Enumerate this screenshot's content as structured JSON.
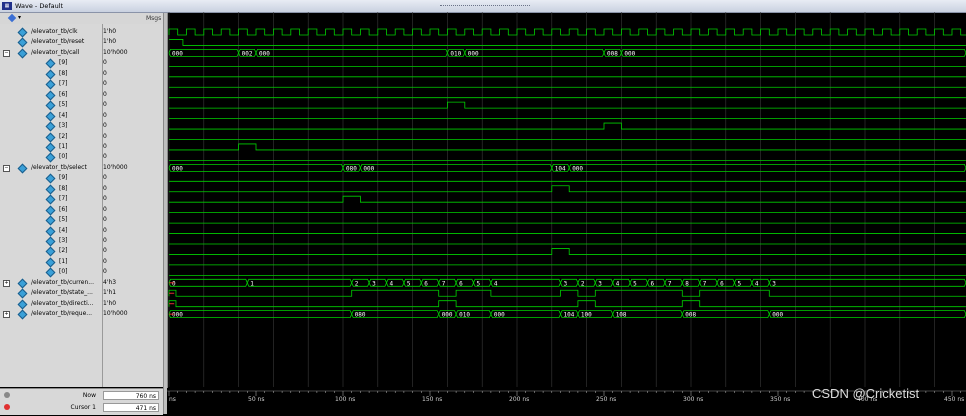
{
  "window": {
    "title": "Wave - Default",
    "icon": "wave-window-icon"
  },
  "header": {
    "msgs_label": "Msgs"
  },
  "signals": [
    {
      "name": "/elevator_tb/clk",
      "value": "1'h0",
      "level": 0,
      "expandable": false
    },
    {
      "name": "/elevator_tb/reset",
      "value": "1'h0",
      "level": 0,
      "expandable": false
    },
    {
      "name": "/elevator_tb/call",
      "value": "10'h000",
      "level": 0,
      "expandable": true,
      "expanded": true
    },
    {
      "name": "[9]",
      "value": "0",
      "level": 1
    },
    {
      "name": "[8]",
      "value": "0",
      "level": 1
    },
    {
      "name": "[7]",
      "value": "0",
      "level": 1
    },
    {
      "name": "[6]",
      "value": "0",
      "level": 1
    },
    {
      "name": "[5]",
      "value": "0",
      "level": 1
    },
    {
      "name": "[4]",
      "value": "0",
      "level": 1
    },
    {
      "name": "[3]",
      "value": "0",
      "level": 1
    },
    {
      "name": "[2]",
      "value": "0",
      "level": 1
    },
    {
      "name": "[1]",
      "value": "0",
      "level": 1
    },
    {
      "name": "[0]",
      "value": "0",
      "level": 1
    },
    {
      "name": "/elevator_tb/select",
      "value": "10'h000",
      "level": 0,
      "expandable": true,
      "expanded": true
    },
    {
      "name": "[9]",
      "value": "0",
      "level": 1
    },
    {
      "name": "[8]",
      "value": "0",
      "level": 1
    },
    {
      "name": "[7]",
      "value": "0",
      "level": 1
    },
    {
      "name": "[6]",
      "value": "0",
      "level": 1
    },
    {
      "name": "[5]",
      "value": "0",
      "level": 1
    },
    {
      "name": "[4]",
      "value": "0",
      "level": 1
    },
    {
      "name": "[3]",
      "value": "0",
      "level": 1
    },
    {
      "name": "[2]",
      "value": "0",
      "level": 1
    },
    {
      "name": "[1]",
      "value": "0",
      "level": 1
    },
    {
      "name": "[0]",
      "value": "0",
      "level": 1
    },
    {
      "name": "/elevator_tb/curren...",
      "value": "4'h3",
      "level": 0,
      "expandable": true,
      "expanded": false
    },
    {
      "name": "/elevator_tb/state_...",
      "value": "1'h1",
      "level": 0,
      "expandable": false
    },
    {
      "name": "/elevator_tb/directi...",
      "value": "1'h0",
      "level": 0,
      "expandable": false
    },
    {
      "name": "/elevator_tb/reque...",
      "value": "10'h000",
      "level": 0,
      "expandable": true,
      "expanded": false
    }
  ],
  "bus_labels": {
    "call": [
      {
        "t": 0,
        "v": "000"
      },
      {
        "t": 40,
        "v": "002"
      },
      {
        "t": 50,
        "v": "000"
      },
      {
        "t": 160,
        "v": "010"
      },
      {
        "t": 170,
        "v": "000"
      },
      {
        "t": 250,
        "v": "008"
      },
      {
        "t": 260,
        "v": "000"
      }
    ],
    "select": [
      {
        "t": 0,
        "v": "000"
      },
      {
        "t": 100,
        "v": "080"
      },
      {
        "t": 110,
        "v": "000"
      },
      {
        "t": 220,
        "v": "104"
      },
      {
        "t": 230,
        "v": "000"
      }
    ],
    "current": [
      {
        "t": 0,
        "v": "0"
      },
      {
        "t": 45,
        "v": "1"
      },
      {
        "t": 105,
        "v": "2"
      },
      {
        "t": 115,
        "v": "3"
      },
      {
        "t": 125,
        "v": "4"
      },
      {
        "t": 135,
        "v": "5"
      },
      {
        "t": 145,
        "v": "6"
      },
      {
        "t": 155,
        "v": "7"
      },
      {
        "t": 165,
        "v": "6"
      },
      {
        "t": 175,
        "v": "5"
      },
      {
        "t": 185,
        "v": "4"
      },
      {
        "t": 225,
        "v": "3"
      },
      {
        "t": 235,
        "v": "2"
      },
      {
        "t": 245,
        "v": "3"
      },
      {
        "t": 255,
        "v": "4"
      },
      {
        "t": 265,
        "v": "5"
      },
      {
        "t": 275,
        "v": "6"
      },
      {
        "t": 285,
        "v": "7"
      },
      {
        "t": 295,
        "v": "8"
      },
      {
        "t": 305,
        "v": "7"
      },
      {
        "t": 315,
        "v": "6"
      },
      {
        "t": 325,
        "v": "5"
      },
      {
        "t": 335,
        "v": "4"
      },
      {
        "t": 345,
        "v": "3"
      }
    ],
    "request": [
      {
        "t": 0,
        "v": "000"
      },
      {
        "t": 105,
        "v": "080"
      },
      {
        "t": 155,
        "v": "000"
      },
      {
        "t": 165,
        "v": "010"
      },
      {
        "t": 185,
        "v": "000"
      },
      {
        "t": 225,
        "v": "104"
      },
      {
        "t": 235,
        "v": "100"
      },
      {
        "t": 255,
        "v": "108"
      },
      {
        "t": 295,
        "v": "008"
      },
      {
        "t": 345,
        "v": "000"
      }
    ]
  },
  "time_axis": {
    "ticks": [
      "ns",
      "50 ns",
      "100 ns",
      "150 ns",
      "200 ns",
      "250 ns",
      "300 ns",
      "350 ns",
      "400 ns",
      "450 ns"
    ]
  },
  "status": {
    "now_label": "Now",
    "now_value": "760 ns",
    "cursor_label": "Cursor 1",
    "cursor_value": "471 ns"
  },
  "watermark": "CSDN @Cricketist",
  "colors": {
    "wave": "#00d000",
    "grid": "#3a3a3a",
    "background": "#000000",
    "red": "#e03030"
  }
}
